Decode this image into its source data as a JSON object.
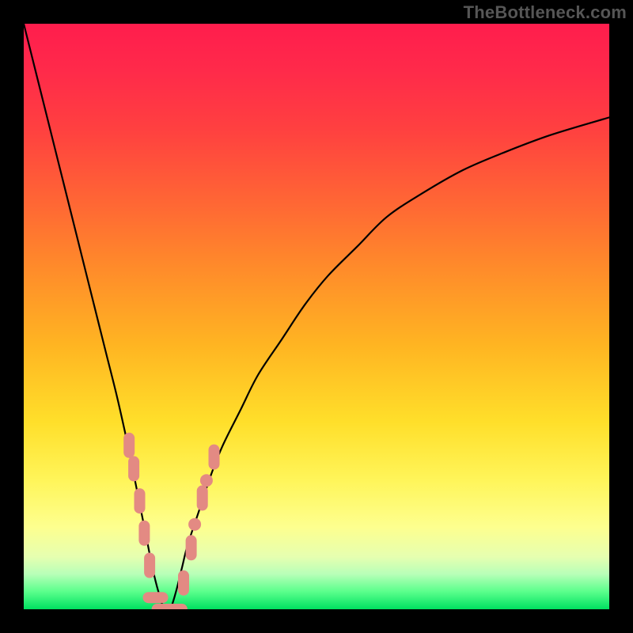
{
  "watermark": "TheBottleneck.com",
  "colors": {
    "background": "#000000",
    "curve": "#000000",
    "marker": "#e38a83",
    "gradient_top": "#ff1d4d",
    "gradient_bottom": "#00e060"
  },
  "chart_data": {
    "type": "line",
    "title": "",
    "xlabel": "",
    "ylabel": "",
    "xlim": [
      0,
      100
    ],
    "ylim": [
      0,
      100
    ],
    "grid": false,
    "series": [
      {
        "name": "curve",
        "x": [
          0,
          2,
          4,
          6,
          8,
          10,
          12,
          14,
          16,
          18,
          19,
          20,
          21,
          22,
          23,
          24,
          25,
          26,
          27,
          28,
          30,
          32,
          34,
          37,
          40,
          44,
          48,
          52,
          57,
          62,
          68,
          75,
          82,
          90,
          100
        ],
        "y": [
          100,
          92,
          84,
          76,
          68,
          60,
          52,
          44,
          36,
          27,
          22,
          17,
          12,
          7,
          3,
          0,
          0,
          3,
          7,
          11,
          17,
          23,
          28,
          34,
          40,
          46,
          52,
          57,
          62,
          67,
          71,
          75,
          78,
          81,
          84
        ]
      }
    ],
    "markers": [
      {
        "x": 18.0,
        "y": 28.0,
        "shape": "vcapsule"
      },
      {
        "x": 18.8,
        "y": 24.0,
        "shape": "vcapsule"
      },
      {
        "x": 19.8,
        "y": 18.5,
        "shape": "vcapsule"
      },
      {
        "x": 20.6,
        "y": 13.0,
        "shape": "vcapsule"
      },
      {
        "x": 21.5,
        "y": 7.5,
        "shape": "vcapsule"
      },
      {
        "x": 22.5,
        "y": 2.0,
        "shape": "hcapsule"
      },
      {
        "x": 24.0,
        "y": 0.0,
        "shape": "hcapsule"
      },
      {
        "x": 25.8,
        "y": 0.0,
        "shape": "hcapsule"
      },
      {
        "x": 27.3,
        "y": 4.5,
        "shape": "vcapsule"
      },
      {
        "x": 28.6,
        "y": 10.5,
        "shape": "vcapsule"
      },
      {
        "x": 29.2,
        "y": 14.5,
        "shape": "dot"
      },
      {
        "x": 30.5,
        "y": 19.0,
        "shape": "vcapsule"
      },
      {
        "x": 31.2,
        "y": 22.0,
        "shape": "dot"
      },
      {
        "x": 32.5,
        "y": 26.0,
        "shape": "vcapsule"
      }
    ]
  }
}
